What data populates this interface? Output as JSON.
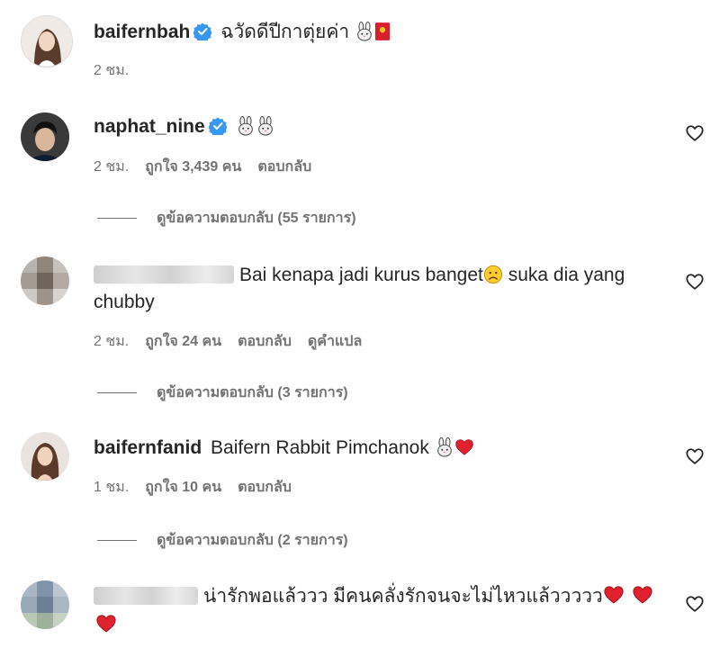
{
  "post": {
    "username": "baifernbah",
    "caption": "ฉวัดดีปีกาตุ่ยค่า",
    "time": "2 ชม."
  },
  "comments": [
    {
      "username": "naphat_nine",
      "text": "",
      "time": "2 ชม.",
      "likes": "ถูกใจ 3,439 คน",
      "reply": "ตอบกลับ",
      "view_replies": "ดูข้อความตอบกลับ (55 รายการ)"
    },
    {
      "username": "",
      "text": "Bai kenapa jadi kurus banget",
      "text2": "suka dia yang",
      "text3": "chubby",
      "time": "2 ชม.",
      "likes": "ถูกใจ 24 คน",
      "reply": "ตอบกลับ",
      "translate": "ดูคำแปล",
      "view_replies": "ดูข้อความตอบกลับ (3 รายการ)"
    },
    {
      "username": "baifernfanid",
      "text": "Baifern Rabbit Pimchanok",
      "time": "1 ชม.",
      "likes": "ถูกใจ 10 คน",
      "reply": "ตอบกลับ",
      "view_replies": "ดูข้อความตอบกลับ (2 รายการ)"
    },
    {
      "username": "",
      "text": "น่ารักพอแล้ววว มีคนคลั่งรักจนจะไม่ไหวแล้ววววว"
    }
  ],
  "icons": {
    "verified": "verified-badge-icon",
    "rabbit": "rabbit-emoji-icon",
    "envelope": "red-envelope-icon",
    "heart": "heart-outline-icon",
    "red_heart": "red-heart-emoji-icon",
    "sad": "sad-face-emoji-icon"
  },
  "colors": {
    "verified": "#3897f0",
    "secondary_text": "#737373",
    "primary_text": "#262626",
    "red_heart": "#e0222e"
  }
}
